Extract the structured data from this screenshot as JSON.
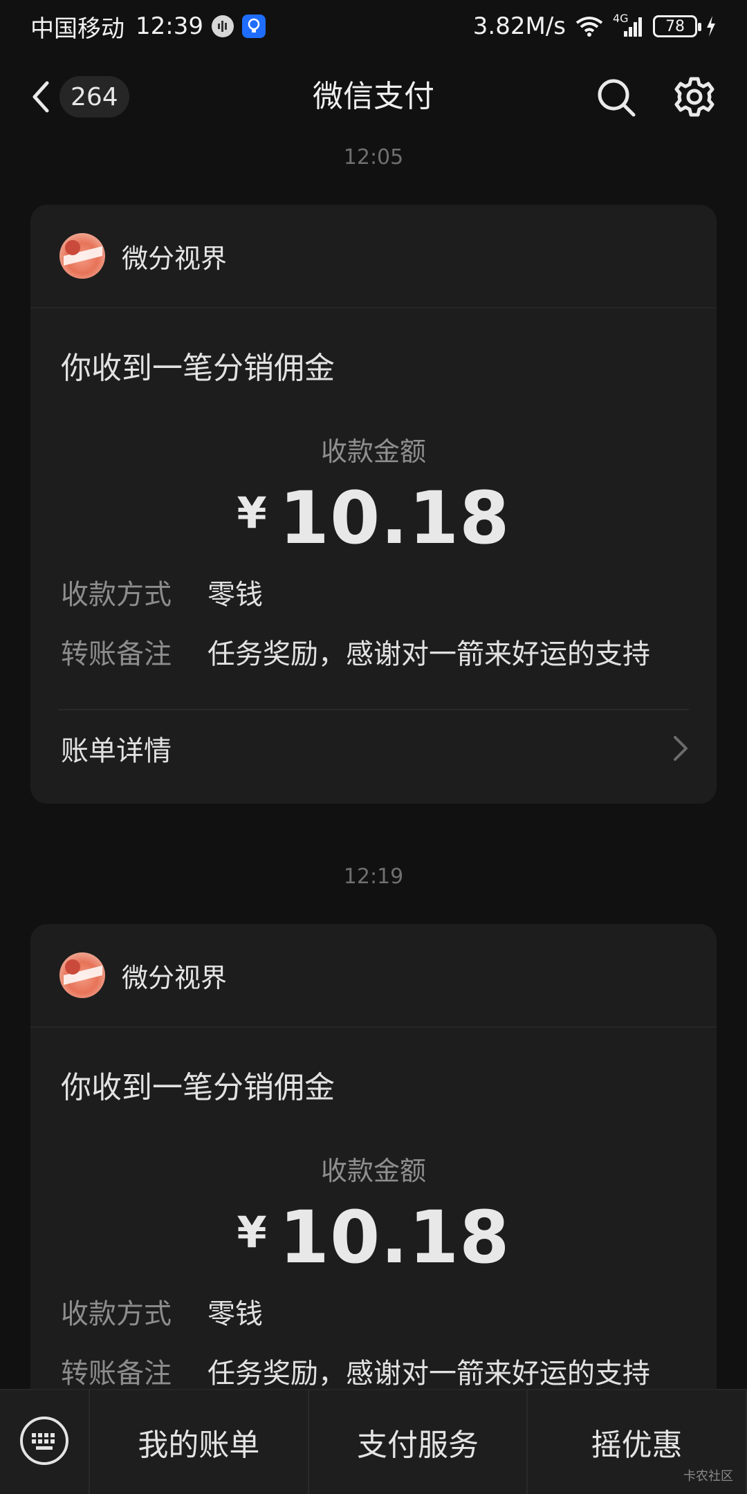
{
  "status_bar": {
    "carrier": "中国移动",
    "time": "12:39",
    "network_speed": "3.82M/s",
    "signal_type": "4G",
    "battery_level": "78"
  },
  "nav": {
    "unread_count": "264",
    "title": "微信支付"
  },
  "messages": [
    {
      "timestamp": "12:05",
      "merchant": "微分视界",
      "title": "你收到一笔分销佣金",
      "amount_label": "收款金额",
      "currency": "¥",
      "amount": "10.18",
      "method_label": "收款方式",
      "method_value": "零钱",
      "note_label": "转账备注",
      "note_value": "任务奖励，感谢对一箭来好运的支持",
      "bill_detail": "账单详情"
    },
    {
      "timestamp": "12:19",
      "merchant": "微分视界",
      "title": "你收到一笔分销佣金",
      "amount_label": "收款金额",
      "currency": "¥",
      "amount": "10.18",
      "method_label": "收款方式",
      "method_value": "零钱",
      "note_label": "转账备注",
      "note_value": "任务奖励，感谢对一箭来好运的支持"
    }
  ],
  "bottom_menu": {
    "items": [
      "我的账单",
      "支付服务",
      "摇优惠"
    ]
  },
  "watermark": "卡农社区"
}
